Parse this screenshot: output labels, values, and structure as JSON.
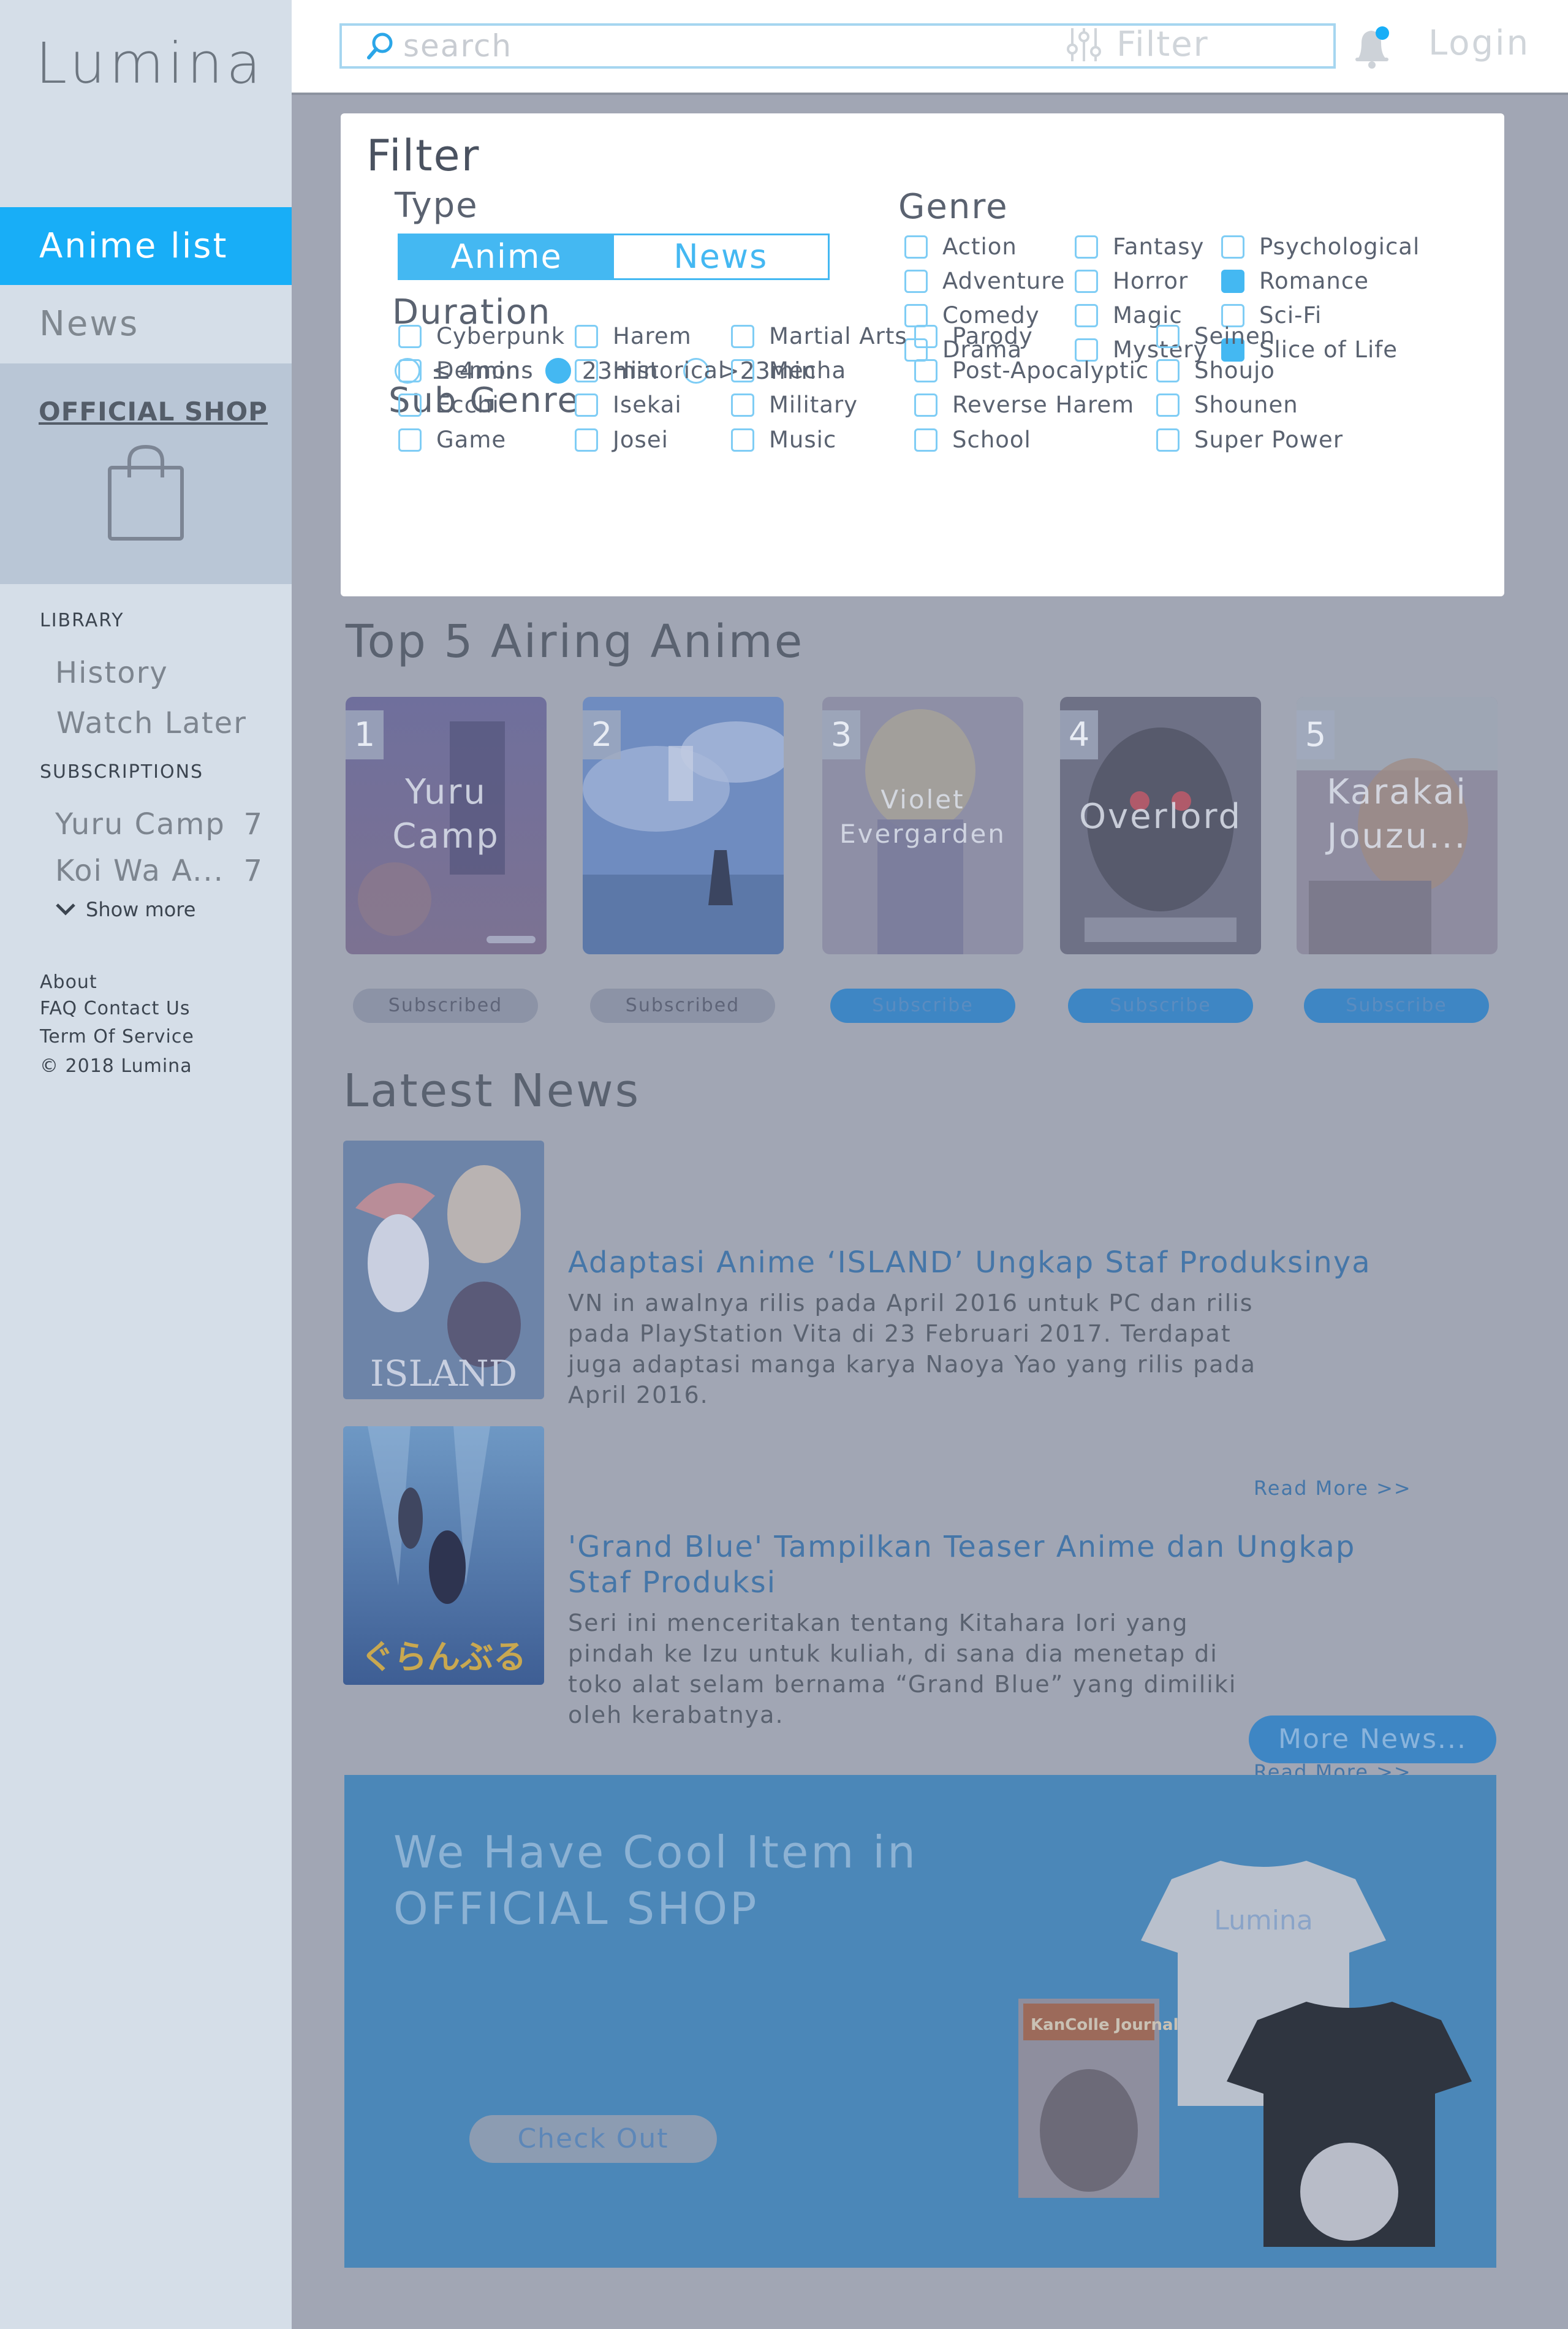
{
  "app": {
    "logo": "Lumina"
  },
  "sidebar": {
    "nav": [
      {
        "label": "Anime list",
        "active": true
      },
      {
        "label": "News",
        "active": false
      }
    ],
    "shop_title": "OFFICIAL SHOP",
    "library_title": "LIBRARY",
    "library_items": [
      "History",
      "Watch Later"
    ],
    "subscriptions_title": "SUBSCRIPTIONS",
    "subscriptions": [
      {
        "name": "Yuru Camp",
        "count": "7"
      },
      {
        "name": "Koi Wa A...",
        "count": "7"
      }
    ],
    "show_more": "Show more",
    "footer": [
      "About",
      "FAQ  Contact Us",
      "Term Of Service",
      "© 2018 Lumina"
    ]
  },
  "header": {
    "search_placeholder": "search",
    "filter_label": "Filter",
    "login_label": "Login"
  },
  "filter": {
    "title": "Filter",
    "type_title": "Type",
    "type_options": [
      "Anime",
      "News"
    ],
    "type_selected": "Anime",
    "duration_title": "Duration",
    "duration_options": [
      "≤ 4min",
      "23min",
      ">23min"
    ],
    "duration_selected": "23min",
    "genre_title": "Genre",
    "genres": [
      {
        "label": "Action",
        "checked": false
      },
      {
        "label": "Adventure",
        "checked": false
      },
      {
        "label": "Comedy",
        "checked": false
      },
      {
        "label": "Drama",
        "checked": false
      },
      {
        "label": "Fantasy",
        "checked": false
      },
      {
        "label": "Horror",
        "checked": false
      },
      {
        "label": "Magic",
        "checked": false
      },
      {
        "label": "Mystery",
        "checked": false
      },
      {
        "label": "Psychological",
        "checked": false
      },
      {
        "label": "Romance",
        "checked": true
      },
      {
        "label": "Sci-Fi",
        "checked": false
      },
      {
        "label": "Slice of Life",
        "checked": true
      }
    ],
    "subgenre_title": "Sub Genre",
    "subgenres": [
      "Cyberpunk",
      "Demons",
      "Ecchi",
      "Game",
      "Harem",
      "Historical",
      "Isekai",
      "Josei",
      "Martial Arts",
      "Mecha",
      "Military",
      "Music",
      "Parody",
      "Post-Apocalyptic",
      "Reverse Harem",
      "School",
      "Seinen",
      "Shoujo",
      "Shounen",
      "Super Power"
    ]
  },
  "top5": {
    "title": "Top 5 Airing Anime",
    "items": [
      {
        "rank": "1",
        "title": "Yuru Camp",
        "button": "Subscribed",
        "subscribed": true
      },
      {
        "rank": "2",
        "title": "",
        "button": "Subscribed",
        "subscribed": true
      },
      {
        "rank": "3",
        "title": "Violet Evergarden",
        "button": "Subscribe",
        "subscribed": false
      },
      {
        "rank": "4",
        "title": "Overlord",
        "button": "Subscribe",
        "subscribed": false
      },
      {
        "rank": "5",
        "title": "Karakai Jouzu...",
        "button": "Subscribe",
        "subscribed": false
      }
    ]
  },
  "news": {
    "title": "Latest News",
    "items": [
      {
        "title": "Adaptasi Anime ‘ISLAND’ Ungkap Staf Produksinya",
        "body": "VN in awalnya rilis pada April 2016 untuk PC dan rilis pada PlayStation Vita di 23 Februari 2017. Terdapat juga adaptasi manga karya Naoya Yao yang rilis pada April 2016.",
        "read_more": "Read More >>",
        "image_text": "ISLAND"
      },
      {
        "title": "'Grand Blue' Tampilkan Teaser Anime dan Ungkap Staf Produksi",
        "body": "Seri ini menceritakan tentang Kitahara Iori yang pindah ke Izu untuk kuliah, di sana dia menetap di toko alat selam bernama “Grand Blue” yang dimiliki oleh kerabatnya.",
        "read_more": "Read More >>",
        "image_text": "ぐらんぶる"
      }
    ],
    "more_label": "More News..."
  },
  "banner": {
    "line1": "We Have Cool Item in",
    "line2": "OFFICIAL SHOP",
    "button": "Check Out",
    "shirt_text": "Lumina",
    "magazine_text": "KanColle Journal"
  },
  "colors": {
    "accent": "#18aef7",
    "overlay": "#a1a6b4",
    "banner": "#4b87b8"
  }
}
